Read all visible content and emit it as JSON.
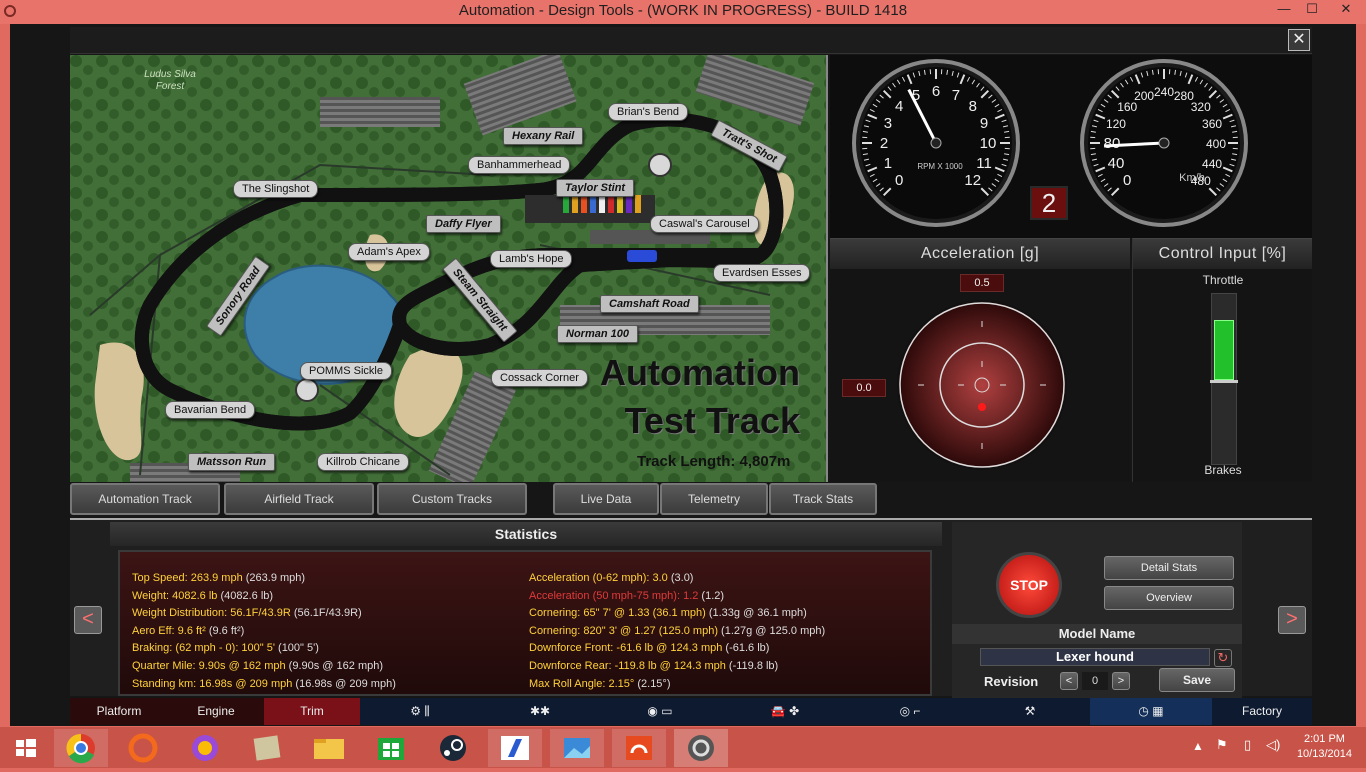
{
  "window": {
    "title": "Automation - Design Tools - (WORK IN PROGRESS) - BUILD 1418",
    "minimize": "—",
    "maximize": "☐",
    "close": "✕"
  },
  "close_button": "✕",
  "track": {
    "forest_label": "Ludus Silva Forest",
    "title_line1": "Automation",
    "title_line2": "Test Track",
    "length": "Track Length: 4,807m",
    "corners": [
      "Brian's Bend",
      "Hexany Rail",
      "Tratt's Shot",
      "Banhammerhead",
      "Taylor Stint",
      "The Slingshot",
      "Daffy Flyer",
      "Caswal's Carousel",
      "Adam's Apex",
      "Lamb's Hope",
      "Evardsen Esses",
      "Sonory Road",
      "Steam Straight",
      "Camshaft Road",
      "Norman 100",
      "POMMS Sickle",
      "Cossack Corner",
      "Bavarian Bend",
      "Matsson Run",
      "Killrob Chicane"
    ]
  },
  "rpm_gauge": {
    "ticks": [
      "0",
      "1",
      "2",
      "3",
      "4",
      "5",
      "6",
      "7",
      "8",
      "9",
      "10",
      "11",
      "12"
    ],
    "label": "RPM X 1000",
    "value": 4.8
  },
  "speed_gauge": {
    "ticks": [
      "0",
      "40",
      "80",
      "120",
      "160",
      "200",
      "240",
      "280",
      "320",
      "360",
      "400",
      "440",
      "480"
    ],
    "unit": "Km/h",
    "value": 75
  },
  "gear": "2",
  "accel": {
    "title": "Acceleration [g]",
    "longitudinal": "0.5",
    "lateral": "0.0"
  },
  "control": {
    "title": "Control Input [%]",
    "throttle_label": "Throttle",
    "brakes_label": "Brakes",
    "throttle_level": 0.5
  },
  "tabs": {
    "automation_track": "Automation Track",
    "airfield_track": "Airfield Track",
    "custom_tracks": "Custom Tracks",
    "live_data": "Live Data",
    "telemetry": "Telemetry",
    "track_stats": "Track Stats"
  },
  "statistics": {
    "title": "Statistics",
    "left": [
      {
        "k": "Top Speed: 263.9 mph",
        "v": " (263.9 mph)"
      },
      {
        "k": "Weight: 4082.6 lb",
        "v": " (4082.6 lb)"
      },
      {
        "k": "Weight Distribution: 56.1F/43.9R",
        "v": " (56.1F/43.9R)"
      },
      {
        "k": "Aero Eff: 9.6 ft²",
        "v": " (9.6 ft²)"
      },
      {
        "k": "Braking: (62 mph - 0): 100\" 5'",
        "v": " (100\" 5')"
      },
      {
        "k": "Quarter Mile: 9.90s @ 162 mph",
        "v": " (9.90s @ 162 mph)"
      },
      {
        "k": "Standing km: 16.98s @ 209 mph",
        "v": " (16.98s @ 209 mph)"
      }
    ],
    "right": [
      {
        "k": "Acceleration (0-62 mph): 3.0",
        "v": " (3.0)"
      },
      {
        "k": "Acceleration (50 mph-75 mph): 1.2",
        "v": " (1.2)"
      },
      {
        "k": "Cornering: 65\" 7' @ 1.33 (36.1 mph)",
        "v": " (1.33g @ 36.1 mph)"
      },
      {
        "k": "Cornering: 820\" 3' @ 1.27 (125.0 mph)",
        "v": " (1.27g @ 125.0 mph)"
      },
      {
        "k": "Downforce Front: -61.6 lb @ 124.3 mph",
        "v": " (-61.6 lb)"
      },
      {
        "k": "Downforce Rear: -119.8 lb @ 124.3 mph",
        "v": " (-119.8 lb)"
      },
      {
        "k": "Max Roll Angle: 2.15°",
        "v": " (2.15°)"
      }
    ]
  },
  "controls": {
    "stop": "STOP",
    "detail_stats": "Detail Stats",
    "overview": "Overview",
    "model_name_label": "Model Name",
    "model_name": "Lexer hound",
    "revision_label": "Revision",
    "revision": "0",
    "save": "Save",
    "prev": "<",
    "next": ">",
    "dec": "<",
    "inc": ">"
  },
  "bottom_nav": {
    "platform": "Platform",
    "engine": "Engine",
    "trim": "Trim",
    "factory": "Factory"
  },
  "clock": {
    "time": "2:01 PM",
    "date": "10/13/2014"
  }
}
